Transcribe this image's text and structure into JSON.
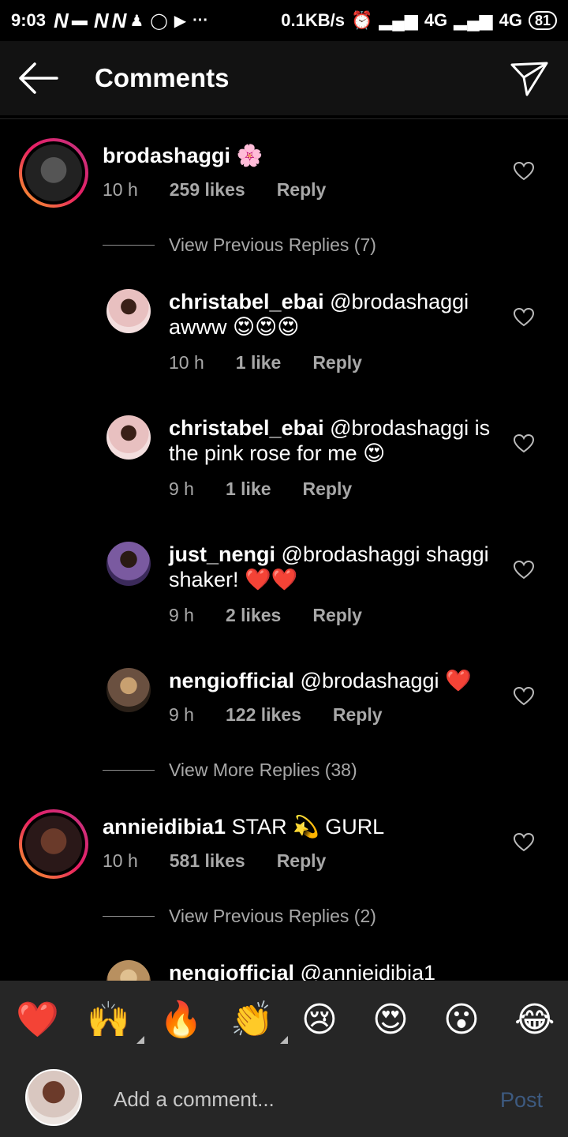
{
  "status_bar": {
    "time": "9:03",
    "speed": "0.1KB/s",
    "net1": "4G",
    "net2": "4G",
    "battery": "81"
  },
  "header": {
    "title": "Comments"
  },
  "comments": [
    {
      "username": "brodashaggi",
      "text": "🌸",
      "time": "10 h",
      "likes": "259 likes",
      "reply": "Reply",
      "view_replies": "View Previous Replies (7)",
      "avatar_color": "#3a3a3a"
    },
    {
      "username": "christabel_ebai",
      "text": "@brodashaggi awww 😍😍😍",
      "time": "10 h",
      "likes": "1 like",
      "reply": "Reply",
      "avatar_color": "#c98a8a"
    },
    {
      "username": "christabel_ebai",
      "text": "@brodashaggi is the pink rose for me 😍",
      "time": "9 h",
      "likes": "1 like",
      "reply": "Reply",
      "avatar_color": "#c98a8a"
    },
    {
      "username": "just_nengi",
      "text": "@brodashaggi shaggi shaker! ❤️❤️",
      "time": "9 h",
      "likes": "2 likes",
      "reply": "Reply",
      "avatar_color": "#6a4a8a"
    },
    {
      "username": "nengiofficial",
      "text": "@brodashaggi ❤️",
      "time": "9 h",
      "likes": "122 likes",
      "reply": "Reply",
      "view_replies": "View More Replies (38)",
      "avatar_color": "#8a6a4a"
    },
    {
      "username": "annieidibia1",
      "text": "STAR 💫 GURL",
      "time": "10 h",
      "likes": "581 likes",
      "reply": "Reply",
      "view_replies": "View Previous Replies (2)",
      "avatar_color": "#4a2a2a"
    },
    {
      "username": "nengiofficial",
      "text": "@annieidibia1",
      "avatar_color": "#b8956a"
    }
  ],
  "emoji_bar": [
    "❤️",
    "🙌",
    "🔥",
    "👏",
    "😢",
    "😍",
    "😮",
    "😂"
  ],
  "input": {
    "placeholder": "Add a comment...",
    "post_label": "Post"
  },
  "colors": {
    "meta_text": "#a8a8a8",
    "post_button": "#3d5a80",
    "bar_bg": "#262626"
  }
}
